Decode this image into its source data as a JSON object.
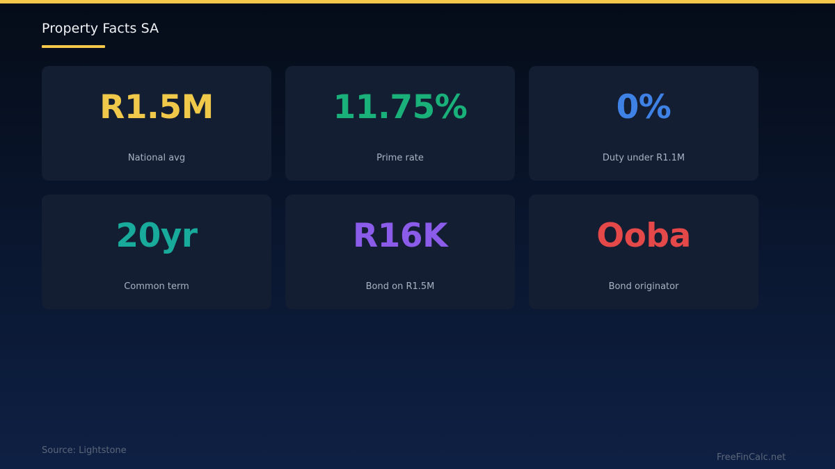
{
  "title": "Property Facts SA",
  "colors": {
    "accent": "#f5c84c",
    "card_bg": "#141e33",
    "label": "#a9b2c3"
  },
  "cards": [
    {
      "value": "R1.5M",
      "label": "National avg",
      "color": "#f0c94a"
    },
    {
      "value": "11.75%",
      "label": "Prime rate",
      "color": "#19b07a"
    },
    {
      "value": "0%",
      "label": "Duty under R1.1M",
      "color": "#3f82e6"
    },
    {
      "value": "20yr",
      "label": "Common term",
      "color": "#18ab9c"
    },
    {
      "value": "R16K",
      "label": "Bond on R1.5M",
      "color": "#8a5ce9"
    },
    {
      "value": "Ooba",
      "label": "Bond originator",
      "color": "#e54848"
    }
  ],
  "source": "Source: Lightstone",
  "watermark": "FreeFinCalc.net"
}
